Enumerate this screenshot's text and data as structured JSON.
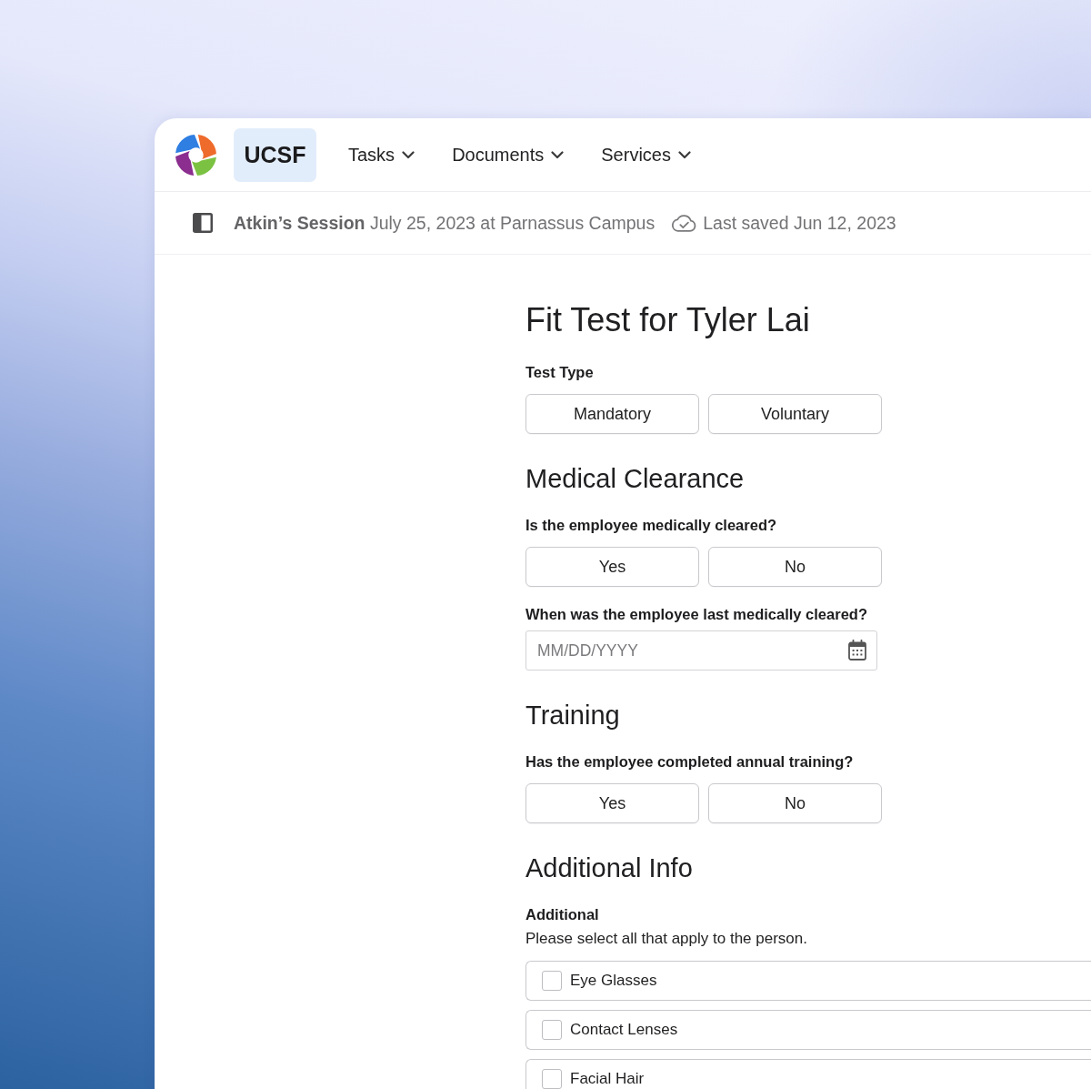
{
  "nav": {
    "brand": "UCSF",
    "menus": [
      {
        "label": "Tasks"
      },
      {
        "label": "Documents"
      },
      {
        "label": "Services"
      }
    ]
  },
  "session_bar": {
    "session": "**Atkin’s Session** July 25, 2023 at Parnassus Campus",
    "save_status": "Last saved Jun 12, 2023"
  },
  "form": {
    "title": "Fit Test for Tyler Lai",
    "fields": [
      {
        "kind": "choice",
        "label": "Test Type",
        "options": [
          {
            "label": "Mandatory",
            "selected": false
          },
          {
            "label": "Voluntary",
            "selected": false
          }
        ]
      },
      {
        "kind": "heading",
        "text": "Medical Clearance"
      },
      {
        "kind": "choice",
        "label": "Is the employee medically cleared?",
        "options": [
          {
            "label": "Yes",
            "selected": false
          },
          {
            "label": "No",
            "selected": false
          }
        ]
      },
      {
        "kind": "date",
        "label": "When was the employee last medically cleared?",
        "placeholder": "MM/DD/YYYY"
      },
      {
        "kind": "heading",
        "text": "Training"
      },
      {
        "kind": "choice",
        "label": "Has the employee completed annual training?",
        "options": [
          {
            "label": "Yes",
            "selected": false
          },
          {
            "label": "No",
            "selected": false
          }
        ]
      },
      {
        "kind": "heading",
        "text": "Additional Info"
      },
      {
        "kind": "checklist",
        "label": "Additional",
        "hint": "Please select all that apply to the person.",
        "options": [
          {
            "label": "Eye Glasses",
            "checked": false
          },
          {
            "label": "Contact Lenses",
            "checked": false
          },
          {
            "label": "Facial Hair",
            "checked": false
          }
        ]
      }
    ]
  }
}
